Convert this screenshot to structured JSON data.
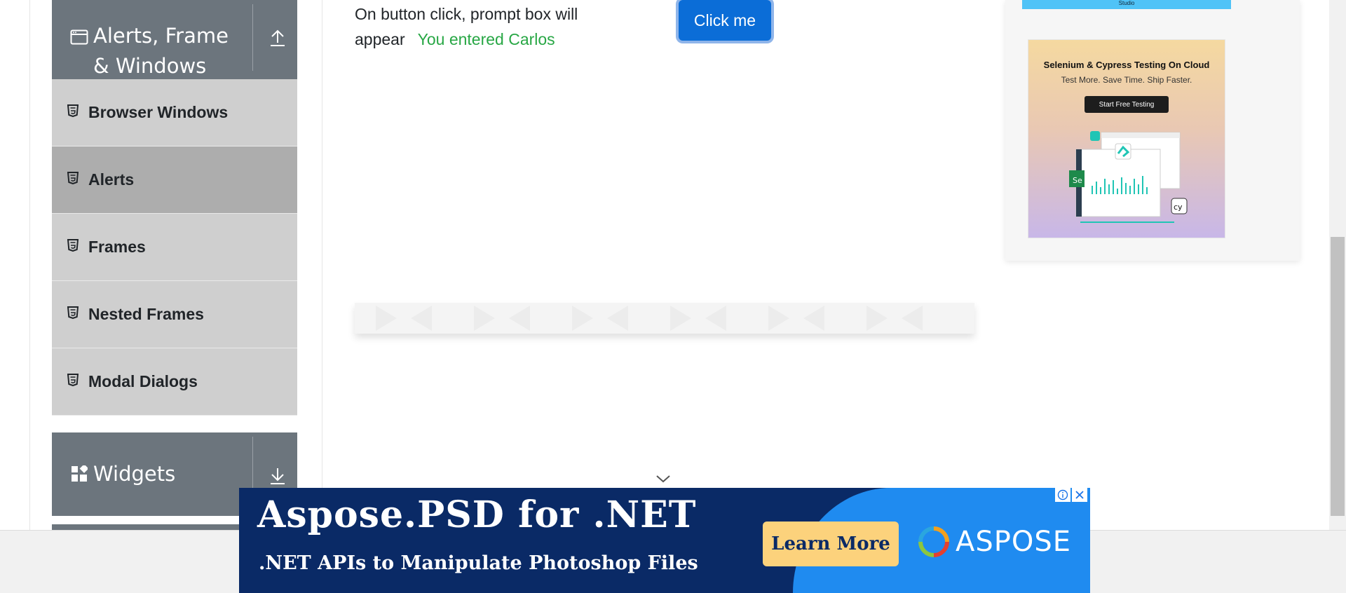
{
  "sidebar": {
    "alerts_group": {
      "title": "Alerts, Frame & Windows",
      "icon": "window-icon",
      "toggle_icon": "arrow-up-icon"
    },
    "items": [
      {
        "label": "Browser Windows",
        "icon": "html5-icon",
        "active": false
      },
      {
        "label": "Alerts",
        "icon": "html5-icon",
        "active": true
      },
      {
        "label": "Frames",
        "icon": "html5-icon",
        "active": false
      },
      {
        "label": "Nested Frames",
        "icon": "html5-icon",
        "active": false
      },
      {
        "label": "Modal Dialogs",
        "icon": "html5-icon",
        "active": false
      }
    ],
    "widgets_group": {
      "title": "Widgets",
      "icon": "widgets-icon",
      "toggle_icon": "arrow-down-icon"
    }
  },
  "main": {
    "prompt_text": "On button click, prompt box will appear",
    "prompt_result": "You entered Carlos",
    "click_button": "Click me",
    "scroll_icon": "chevron-down-icon"
  },
  "right_ad": {
    "top_strip_text": "Studio",
    "title": "Selenium & Cypress Testing On Cloud",
    "subtitle": "Test More. Save Time. Ship Faster.",
    "button": "Start Free Testing"
  },
  "bottom_ad": {
    "headline": "Aspose.PSD for .NET",
    "tagline": ".NET APIs to Manipulate Photoshop Files",
    "button": "Learn More",
    "brand": "ASPOSE"
  },
  "colors": {
    "sidebar_header": "#6c757d",
    "menu_item": "#cfcfcf",
    "menu_item_active": "#adadad",
    "primary_button": "#0b6dd7",
    "success_text": "#28a745",
    "ad_dark": "#0a2a66",
    "ad_light": "#1f8bf0",
    "ad_button": "#fcd27c"
  }
}
